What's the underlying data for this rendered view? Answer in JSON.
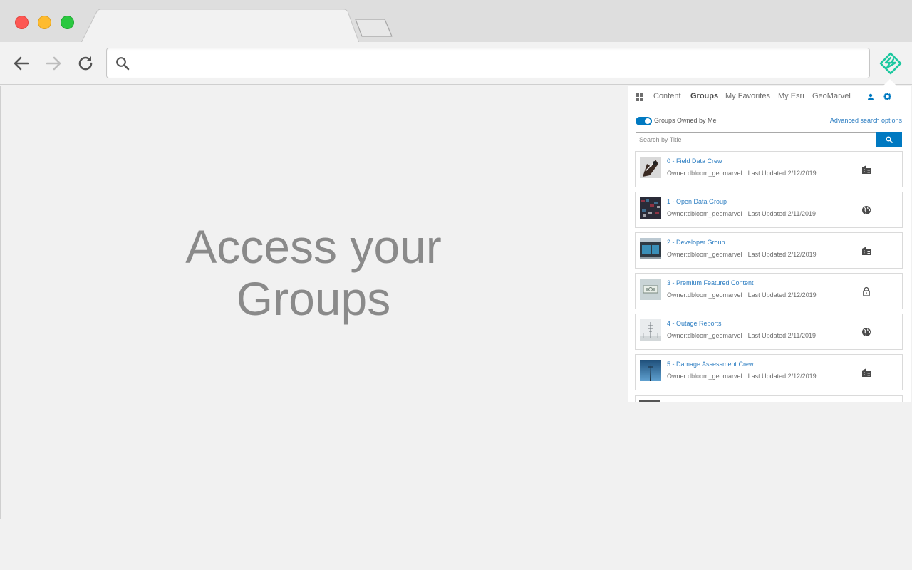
{
  "browser": {
    "address_placeholder": "",
    "address_value": ""
  },
  "hero": {
    "line1": "Access your",
    "line2": "Groups"
  },
  "popup": {
    "nav": [
      {
        "label": "Content"
      },
      {
        "label": "Groups",
        "active": true
      },
      {
        "label": "My Favorites"
      },
      {
        "label": "My Esri"
      },
      {
        "label": "GeoMarvel"
      }
    ],
    "toggle_label": "Groups Owned by Me",
    "advanced_link": "Advanced search options",
    "search_placeholder": "Search by Title",
    "accent_color": "#0079c1",
    "groups": [
      {
        "title": "0 - Field Data Crew",
        "owner": "Owner:dbloom_geomarvel",
        "updated": "Last Updated:2/12/2019",
        "access_icon": "organization-icon"
      },
      {
        "title": "1 - Open Data Group",
        "owner": "Owner:dbloom_geomarvel",
        "updated": "Last Updated:2/11/2019",
        "access_icon": "globe-icon"
      },
      {
        "title": "2 - Developer Group",
        "owner": "Owner:dbloom_geomarvel",
        "updated": "Last Updated:2/12/2019",
        "access_icon": "organization-icon"
      },
      {
        "title": "3 - Premium Featured Content",
        "owner": "Owner:dbloom_geomarvel",
        "updated": "Last Updated:2/12/2019",
        "access_icon": "lock-icon"
      },
      {
        "title": "4 - Outage Reports",
        "owner": "Owner:dbloom_geomarvel",
        "updated": "Last Updated:2/11/2019",
        "access_icon": "globe-icon"
      },
      {
        "title": "5 - Damage Assessment Crew",
        "owner": "Owner:dbloom_geomarvel",
        "updated": "Last Updated:2/12/2019",
        "access_icon": "organization-icon"
      }
    ]
  }
}
